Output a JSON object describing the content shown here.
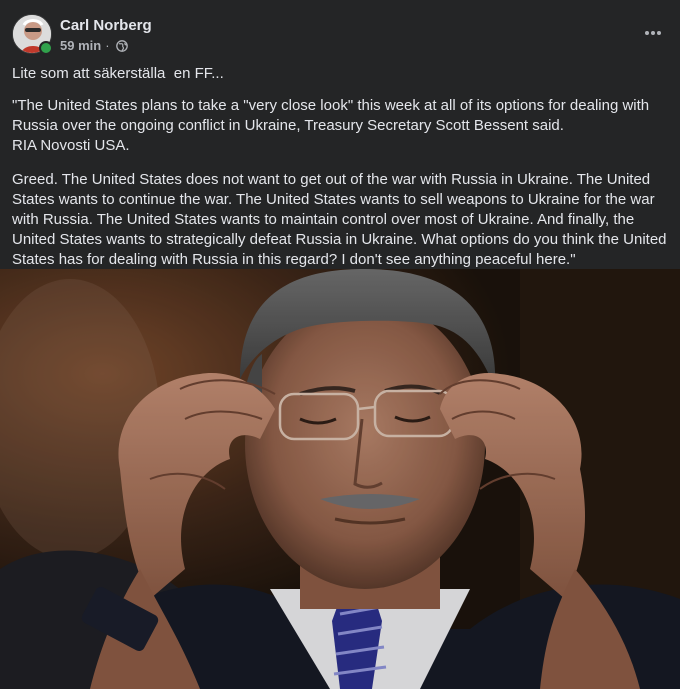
{
  "post": {
    "author_name": "Carl Norberg",
    "time": "59 min",
    "separator": "·",
    "privacy_icon": "globe-icon",
    "more_icon": "more-options-icon",
    "paragraphs": [
      "Lite som att säkerställa  en FF...",
      "\"The United States plans to take a \"very close look\" this week at all of its options for dealing with Russia over the ongoing conflict in Ukraine, Treasury Secretary Scott Bessent said.\nRIA Novosti USA.",
      "Greed. The United States does not want to get out of the war with Russia in Ukraine. The United States wants to continue the war. The United States wants to sell weapons to Ukraine for the war with Russia. The United States wants to maintain control over most of Ukraine. And finally, the United States wants to strategically defeat Russia in Ukraine. What options do you think the United States has for dealing with Russia in this regard? I don't see anything peaceful here.\""
    ],
    "image_icon": "photo-of-man-adjusting-glasses"
  },
  "colors": {
    "card_bg": "#242526",
    "text_primary": "#e4e6eb",
    "text_secondary": "#b0b3b8",
    "online": "#31a24c"
  }
}
